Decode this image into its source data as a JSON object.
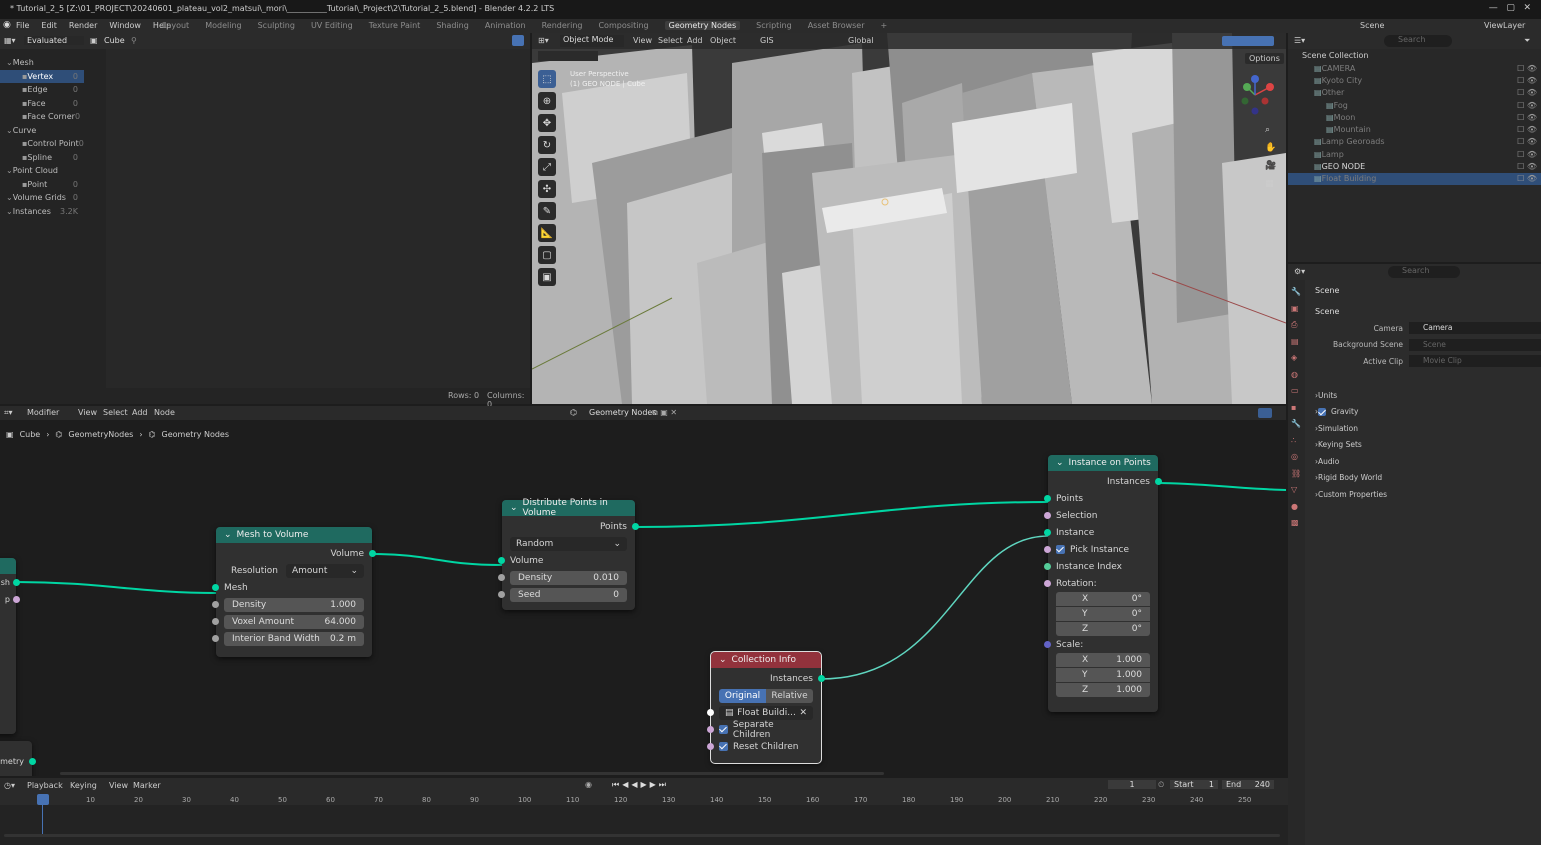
{
  "titlebar": {
    "title": "* Tutorial_2_5 [Z:\\01_PROJECT\\20240601_plateau_vol2_matsui\\_mori\\__________Tutorial\\_Project\\2\\Tutorial_2_5.blend] - Blender 4.2.2 LTS"
  },
  "menu": [
    "File",
    "Edit",
    "Render",
    "Window",
    "Help"
  ],
  "workspaces": [
    "Layout",
    "Modeling",
    "Sculpting",
    "UV Editing",
    "Texture Paint",
    "Shading",
    "Animation",
    "Rendering",
    "Compositing",
    "Geometry Nodes",
    "Scripting",
    "Asset Browser"
  ],
  "scene_selector": {
    "scene": "Scene",
    "view_layer": "ViewLayer"
  },
  "spreadsheet": {
    "header": {
      "mode": "Evaluated",
      "object": "Cube"
    },
    "tree": [
      {
        "label": "Mesh",
        "count": "",
        "level": 0
      },
      {
        "label": "Vertex",
        "count": "0",
        "level": 1,
        "selected": true
      },
      {
        "label": "Edge",
        "count": "0",
        "level": 1
      },
      {
        "label": "Face",
        "count": "0",
        "level": 1
      },
      {
        "label": "Face Corner",
        "count": "0",
        "level": 1
      },
      {
        "label": "Curve",
        "count": "",
        "level": 0
      },
      {
        "label": "Control Point",
        "count": "0",
        "level": 1
      },
      {
        "label": "Spline",
        "count": "0",
        "level": 1
      },
      {
        "label": "Point Cloud",
        "count": "",
        "level": 0
      },
      {
        "label": "Point",
        "count": "0",
        "level": 1
      },
      {
        "label": "Volume Grids",
        "count": "0",
        "level": 0
      },
      {
        "label": "Instances",
        "count": "3.2K",
        "level": 0
      }
    ],
    "footer": {
      "rows": "Rows: 0",
      "columns": "Columns: 0"
    }
  },
  "viewport": {
    "header": {
      "mode": "Object Mode",
      "menus": [
        "View",
        "Select",
        "Add",
        "Object"
      ],
      "gis": "GIS",
      "orientation": "Global"
    },
    "options": "Options",
    "overlay_title": "User Perspective",
    "overlay_sub": "(1) GEO NODE | Cube"
  },
  "outliner": {
    "search_placeholder": "Search",
    "root": "Scene Collection",
    "items": [
      {
        "label": "CAMERA",
        "level": 1,
        "dim": true
      },
      {
        "label": "Kyoto City",
        "level": 1,
        "dim": true
      },
      {
        "label": "Other",
        "level": 1,
        "dim": true
      },
      {
        "label": "Fog",
        "level": 2,
        "dim": true
      },
      {
        "label": "Moon",
        "level": 2,
        "dim": true
      },
      {
        "label": "Mountain",
        "level": 2,
        "dim": true
      },
      {
        "label": "Lamp Georoads",
        "level": 1,
        "dim": true
      },
      {
        "label": "Lamp",
        "level": 1,
        "dim": true
      },
      {
        "label": "GEO NODE",
        "level": 1,
        "dim": false
      },
      {
        "label": "Float Building",
        "level": 1,
        "dim": true,
        "selected": true
      }
    ]
  },
  "properties": {
    "search_placeholder": "Search",
    "breadcrumb": "Scene",
    "section": "Scene",
    "fields": [
      {
        "label": "Camera",
        "value": "Camera"
      },
      {
        "label": "Background Scene",
        "value": "Scene"
      },
      {
        "label": "Active Clip",
        "value": "Movie Clip"
      }
    ],
    "panels": [
      "Units",
      "Gravity",
      "Simulation",
      "Keying Sets",
      "Audio",
      "Rigid Body World",
      "Custom Properties"
    ]
  },
  "node_editor": {
    "header": {
      "editor": "Modifier",
      "menus": [
        "View",
        "Select",
        "Add",
        "Node"
      ],
      "tree_name": "Geometry Nodes"
    },
    "breadcrumb": [
      "Cube",
      "GeometryNodes",
      "Geometry Nodes"
    ],
    "left_labels": {
      "mesh_out": "sh",
      "p": "p",
      "geometry": "metry"
    },
    "mesh_to_volume": {
      "title": "Mesh to Volume",
      "out_volume": "Volume",
      "resolution_label": "Resolution",
      "resolution_value": "Amount",
      "in_mesh": "Mesh",
      "density_label": "Density",
      "density_value": "1.000",
      "voxel_label": "Voxel Amount",
      "voxel_value": "64.000",
      "band_label": "Interior Band Width",
      "band_value": "0.2 m"
    },
    "distribute": {
      "title": "Distribute Points in Volume",
      "out_points": "Points",
      "mode": "Random",
      "in_volume": "Volume",
      "density_label": "Density",
      "density_value": "0.010",
      "seed_label": "Seed",
      "seed_value": "0"
    },
    "collection_info": {
      "title": "Collection Info",
      "out_instances": "Instances",
      "btn_original": "Original",
      "btn_relative": "Relative",
      "collection": "Float Buildi...",
      "separate_children": "Separate Children",
      "reset_children": "Reset Children"
    },
    "instance_on_points": {
      "title": "Instance on Points",
      "out_instances": "Instances",
      "points": "Points",
      "selection": "Selection",
      "instance": "Instance",
      "pick_instance": "Pick Instance",
      "instance_index": "Instance Index",
      "rotation": "Rotation:",
      "rot_x": "0°",
      "rot_y": "0°",
      "rot_z": "0°",
      "scale": "Scale:",
      "scale_x": "1.000",
      "scale_y": "1.000",
      "scale_z": "1.000"
    }
  },
  "timeline": {
    "menus": [
      "Playback",
      "Keying",
      "View",
      "Marker"
    ],
    "current_frame": "1",
    "start_label": "Start",
    "start": "1",
    "end_label": "End",
    "end": "240",
    "ticks": [
      "1",
      "10",
      "20",
      "30",
      "40",
      "50",
      "60",
      "70",
      "80",
      "90",
      "100",
      "110",
      "120",
      "130",
      "140",
      "150",
      "160",
      "170",
      "180",
      "190",
      "200",
      "210",
      "220",
      "230",
      "240",
      "250"
    ]
  },
  "colors": {
    "geometry_node": "#1f6a60",
    "input_node": "#92323c",
    "geometry_link": "#00d6a3",
    "selection": "#4772b3"
  }
}
